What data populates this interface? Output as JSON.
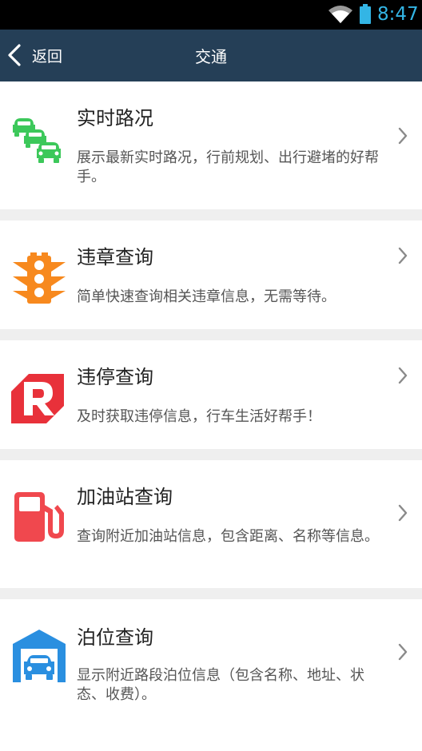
{
  "status_bar": {
    "time": "8:47",
    "icons": [
      "wifi-icon",
      "battery-icon"
    ]
  },
  "nav": {
    "back_label": "返回",
    "title": "交通"
  },
  "items": [
    {
      "icon": "traffic-cars-icon",
      "title": "实时路况",
      "description": "展示最新实时路况，行前规划、出行避堵的好帮手。"
    },
    {
      "icon": "traffic-light-icon",
      "title": "违章查询",
      "description": "简单快速查询相关违章信息，无需等待。"
    },
    {
      "icon": "parking-violation-icon",
      "title": "违停查询",
      "description": "及时获取违停信息，行车生活好帮手！"
    },
    {
      "icon": "gas-station-icon",
      "title": "加油站查询",
      "description": "查询附近加油站信息，包含距离、名称等信息。"
    },
    {
      "icon": "parking-garage-icon",
      "title": "泊位查询",
      "description": "显示附近路段泊位信息（包含名称、地址、状态、收费）。"
    }
  ],
  "colors": {
    "nav_background": "#253f57",
    "status_time": "#33b5e5",
    "green": "#3cc85a",
    "orange": "#f7891e",
    "red": "#e8313a",
    "pink_red": "#f0484e",
    "blue": "#2a8fe0"
  }
}
